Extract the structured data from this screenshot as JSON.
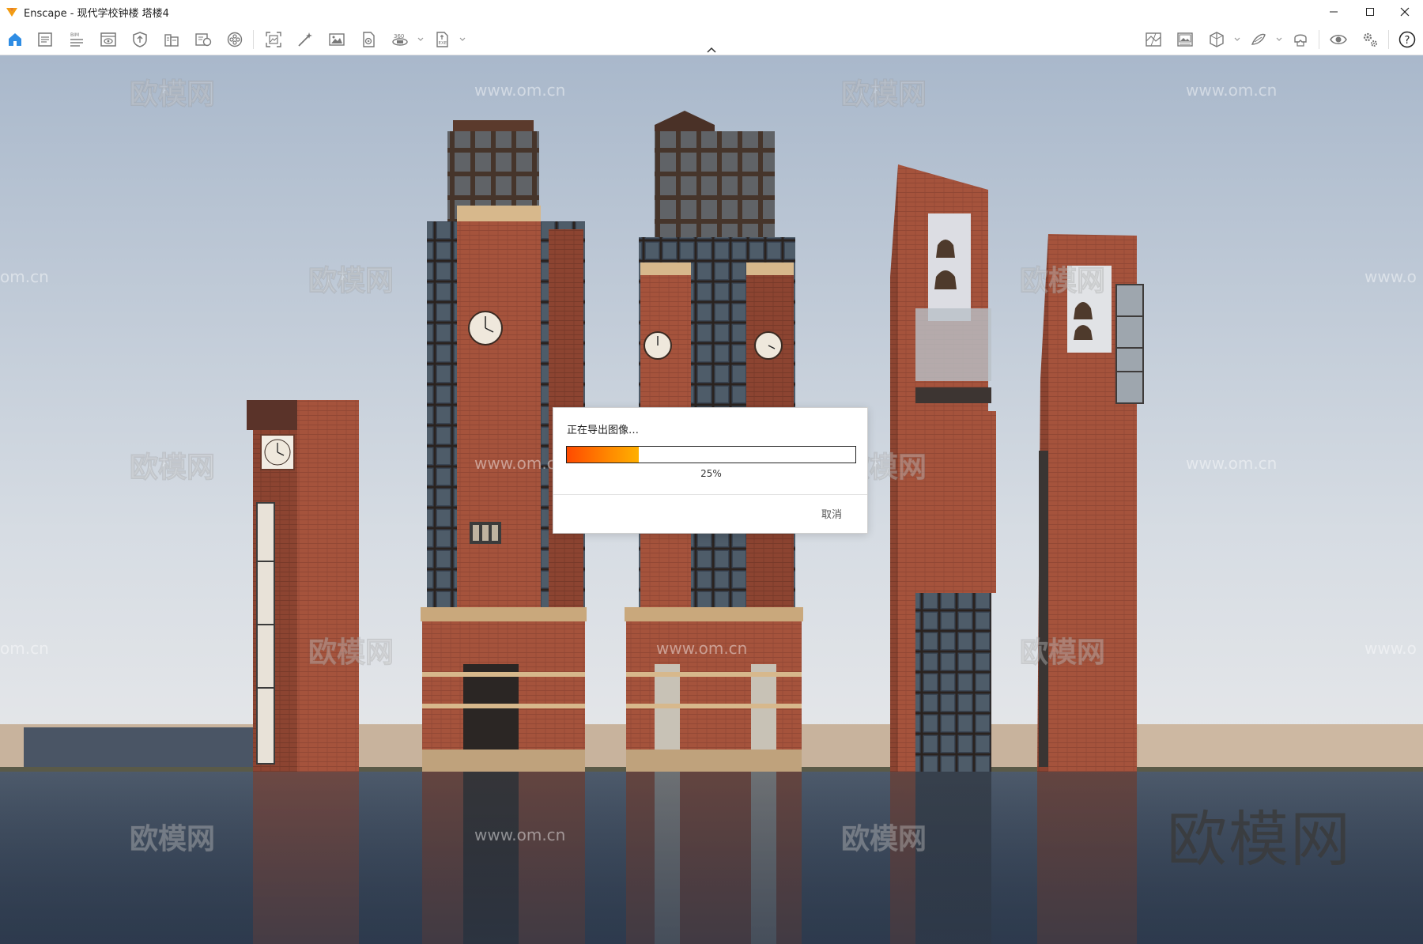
{
  "window": {
    "app_name": "Enscape",
    "title": "Enscape - 现代学校钟楼 塔楼4",
    "controls": {
      "minimize_icon": "minimize-icon",
      "maximize_icon": "maximize-icon",
      "close_icon": "close-icon"
    }
  },
  "toolbar": {
    "left_tools": [
      {
        "name": "home",
        "icon": "home-icon",
        "active": true
      },
      {
        "name": "notes",
        "icon": "notes-icon"
      },
      {
        "name": "bim",
        "icon": "bim-icon",
        "label": "BIM"
      },
      {
        "name": "views",
        "icon": "eye-window-icon"
      },
      {
        "name": "uploads",
        "icon": "shield-upload-icon"
      },
      {
        "name": "asset-library",
        "icon": "building-icon"
      },
      {
        "name": "material-editor",
        "icon": "material-icon"
      },
      {
        "name": "video-editor",
        "icon": "film-reel-icon"
      },
      {
        "name": "screenshot",
        "icon": "frame-capture-icon"
      },
      {
        "name": "batch-render",
        "icon": "magic-wand-icon"
      },
      {
        "name": "render-image",
        "icon": "image-icon"
      },
      {
        "name": "export-video",
        "icon": "document-export-icon"
      },
      {
        "name": "panorama",
        "icon": "panorama-360-icon",
        "label": "360"
      },
      {
        "name": "standalone",
        "icon": "exe-export-icon",
        "label": "EXE"
      }
    ],
    "right_tools": [
      {
        "name": "map",
        "icon": "map-icon"
      },
      {
        "name": "gallery",
        "icon": "gallery-icon"
      },
      {
        "name": "cube-view",
        "icon": "cube-icon"
      },
      {
        "name": "sketch",
        "icon": "sketch-icon"
      },
      {
        "name": "vr",
        "icon": "vr-headset-icon"
      },
      {
        "name": "visual-settings",
        "icon": "eye-icon"
      },
      {
        "name": "settings",
        "icon": "gear-icon"
      },
      {
        "name": "help",
        "icon": "help-icon",
        "label": "?"
      }
    ]
  },
  "watermarks": {
    "cn": "欧模网",
    "url": "www.om.cn",
    "url_partial": "om.cn",
    "url_partial_right": "www.o",
    "brand": "欧模网"
  },
  "dialog": {
    "title": "正在导出图像…",
    "progress_fraction": 0.25,
    "progress_text": "25%",
    "cancel_label": "取消"
  },
  "scene": {
    "sky_top": "#aab9cc",
    "sky_bottom": "#dfe3e8",
    "brick": "#a5533c",
    "brick_dark": "#7e3d2c",
    "stone": "#d7b88c",
    "water": "#2e3b4e"
  }
}
